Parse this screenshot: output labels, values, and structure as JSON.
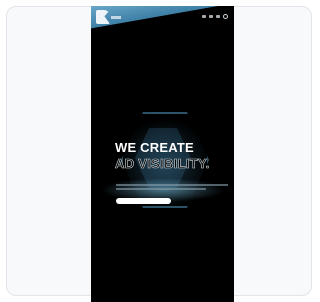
{
  "hero": {
    "title_line1": "WE CREATE",
    "title_line2": "AD VISIBILITY."
  }
}
